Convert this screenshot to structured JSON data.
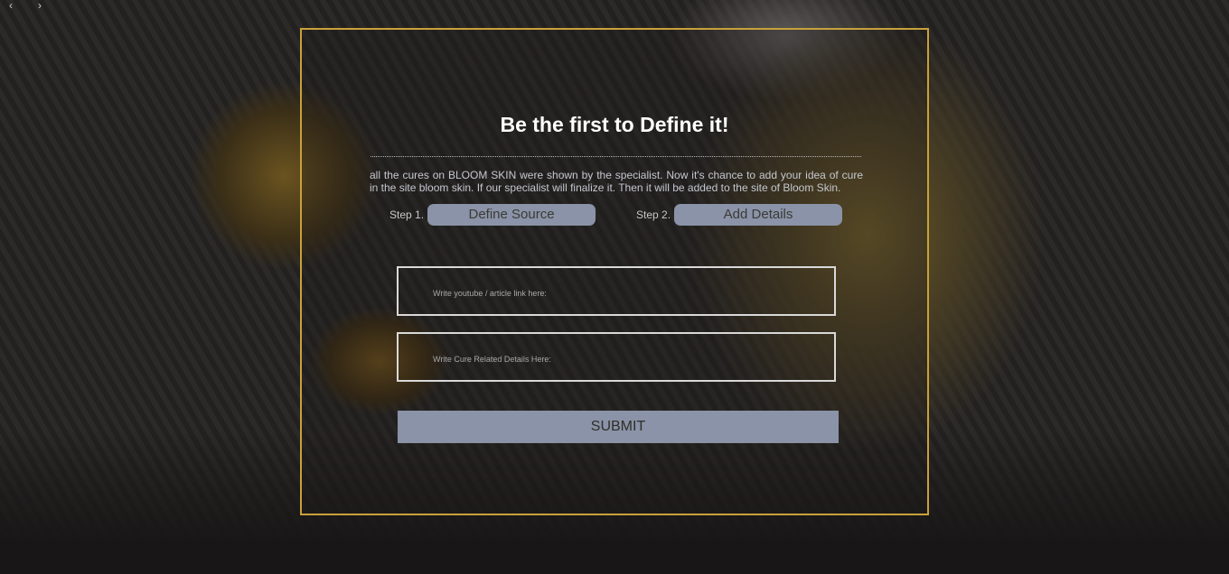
{
  "nav": {
    "prev_arrow": "‹",
    "next_arrow": "›"
  },
  "panel": {
    "title": "Be the first to Define it!",
    "intro": "all the cures on BLOOM SKIN were shown by the specialist. Now it's chance to add your idea of cure in the site bloom skin. If our specialist will finalize it. Then it will be added to the site of Bloom Skin.",
    "steps": [
      {
        "label": "Step 1.",
        "button": "Define Source"
      },
      {
        "label": "Step 2.",
        "button": "Add Details"
      }
    ],
    "fields": [
      {
        "placeholder": "Write youtube / article link here:"
      },
      {
        "placeholder": "Write Cure Related Details Here:"
      }
    ],
    "submit_label": "SUBMIT"
  },
  "colors": {
    "border_accent": "#c9a13a",
    "button_bg": "#8a93a7"
  }
}
